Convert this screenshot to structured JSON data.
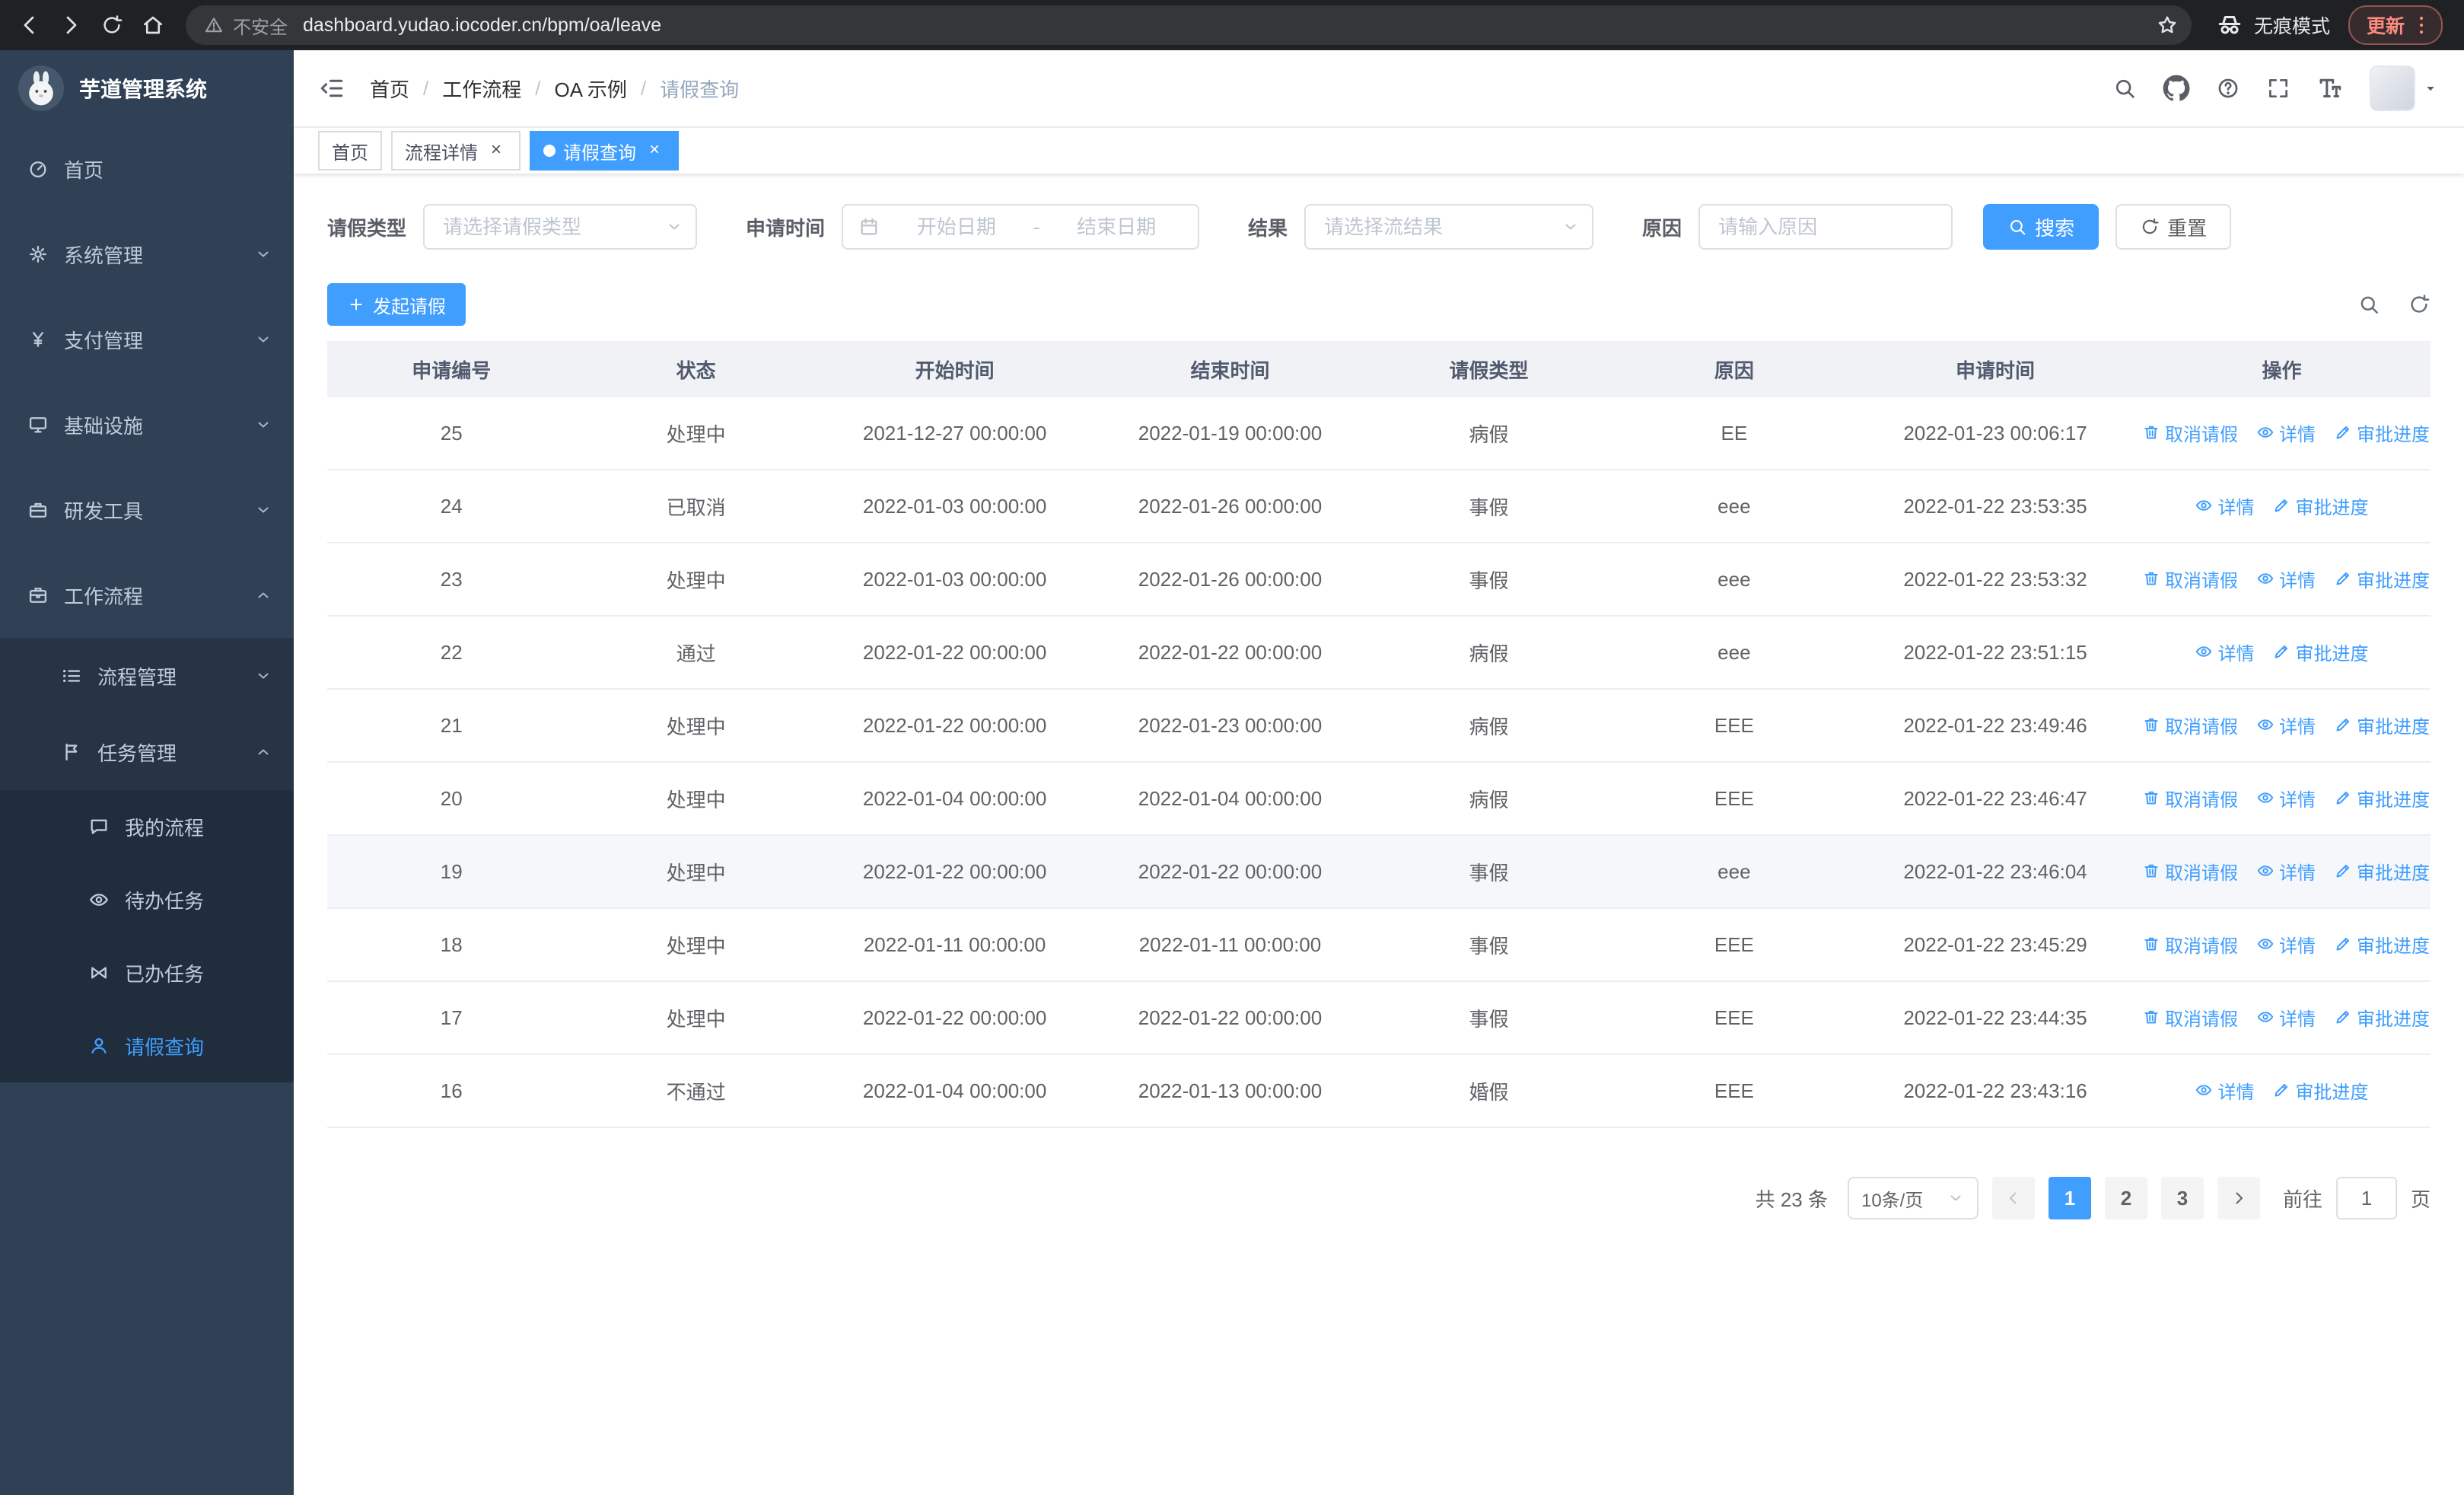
{
  "browser": {
    "security_label": "不安全",
    "url": "dashboard.yudao.iocoder.cn/bpm/oa/leave",
    "incognito_label": "无痕模式",
    "update_label": "更新"
  },
  "sidebar": {
    "logo_title": "芋道管理系统",
    "menu": [
      {
        "name": "home",
        "label": "首页",
        "icon": "dashboard",
        "level": 0
      },
      {
        "name": "system",
        "label": "系统管理",
        "icon": "gear",
        "level": 0,
        "arrow": "down"
      },
      {
        "name": "payment",
        "label": "支付管理",
        "icon": "yen",
        "level": 0,
        "arrow": "down"
      },
      {
        "name": "infrastructure",
        "label": "基础设施",
        "icon": "monitor",
        "level": 0,
        "arrow": "down"
      },
      {
        "name": "devtools",
        "label": "研发工具",
        "icon": "toolbox",
        "level": 0,
        "arrow": "down"
      },
      {
        "name": "workflow",
        "label": "工作流程",
        "icon": "briefcase",
        "level": 0,
        "arrow": "up"
      },
      {
        "name": "process-mgmt",
        "label": "流程管理",
        "icon": "list",
        "level": 1,
        "arrow": "down"
      },
      {
        "name": "task-mgmt",
        "label": "任务管理",
        "icon": "flag",
        "level": 1,
        "arrow": "up"
      },
      {
        "name": "my-process",
        "label": "我的流程",
        "icon": "chat",
        "level": 2
      },
      {
        "name": "todo-tasks",
        "label": "待办任务",
        "icon": "eye",
        "level": 2
      },
      {
        "name": "done-tasks",
        "label": "已办任务",
        "icon": "bowtie",
        "level": 2
      },
      {
        "name": "leave-query",
        "label": "请假查询",
        "icon": "user",
        "level": 2,
        "active": true
      }
    ]
  },
  "header": {
    "breadcrumb": [
      "首页",
      "工作流程",
      "OA 示例",
      "请假查询"
    ]
  },
  "tabs": [
    {
      "label": "首页",
      "closable": false,
      "active": false
    },
    {
      "label": "流程详情",
      "closable": true,
      "active": false
    },
    {
      "label": "请假查询",
      "closable": true,
      "active": true
    }
  ],
  "filters": {
    "leave_type": {
      "label": "请假类型",
      "placeholder": "请选择请假类型"
    },
    "apply_time": {
      "label": "申请时间",
      "start_placeholder": "开始日期",
      "separator": "-",
      "end_placeholder": "结束日期"
    },
    "result": {
      "label": "结果",
      "placeholder": "请选择流结果"
    },
    "reason": {
      "label": "原因",
      "placeholder": "请输入原因"
    },
    "search_label": "搜索",
    "reset_label": "重置"
  },
  "toolbar": {
    "create_label": "发起请假"
  },
  "table": {
    "columns": [
      "申请编号",
      "状态",
      "开始时间",
      "结束时间",
      "请假类型",
      "原因",
      "申请时间",
      "操作"
    ],
    "action_labels": {
      "cancel": "取消请假",
      "detail": "详情",
      "progress": "审批进度"
    },
    "rows": [
      {
        "id": "25",
        "status": "处理中",
        "start": "2021-12-27 00:00:00",
        "end": "2022-01-19 00:00:00",
        "type": "病假",
        "reason": "EE",
        "apply_time": "2022-01-23 00:06:17",
        "actions": [
          "cancel",
          "detail",
          "progress"
        ],
        "highlighted": false
      },
      {
        "id": "24",
        "status": "已取消",
        "start": "2022-01-03 00:00:00",
        "end": "2022-01-26 00:00:00",
        "type": "事假",
        "reason": "eee",
        "apply_time": "2022-01-22 23:53:35",
        "actions": [
          "detail",
          "progress"
        ],
        "highlighted": false
      },
      {
        "id": "23",
        "status": "处理中",
        "start": "2022-01-03 00:00:00",
        "end": "2022-01-26 00:00:00",
        "type": "事假",
        "reason": "eee",
        "apply_time": "2022-01-22 23:53:32",
        "actions": [
          "cancel",
          "detail",
          "progress"
        ],
        "highlighted": false
      },
      {
        "id": "22",
        "status": "通过",
        "start": "2022-01-22 00:00:00",
        "end": "2022-01-22 00:00:00",
        "type": "病假",
        "reason": "eee",
        "apply_time": "2022-01-22 23:51:15",
        "actions": [
          "detail",
          "progress"
        ],
        "highlighted": false
      },
      {
        "id": "21",
        "status": "处理中",
        "start": "2022-01-22 00:00:00",
        "end": "2022-01-23 00:00:00",
        "type": "病假",
        "reason": "EEE",
        "apply_time": "2022-01-22 23:49:46",
        "actions": [
          "cancel",
          "detail",
          "progress"
        ],
        "highlighted": false
      },
      {
        "id": "20",
        "status": "处理中",
        "start": "2022-01-04 00:00:00",
        "end": "2022-01-04 00:00:00",
        "type": "病假",
        "reason": "EEE",
        "apply_time": "2022-01-22 23:46:47",
        "actions": [
          "cancel",
          "detail",
          "progress"
        ],
        "highlighted": false
      },
      {
        "id": "19",
        "status": "处理中",
        "start": "2022-01-22 00:00:00",
        "end": "2022-01-22 00:00:00",
        "type": "事假",
        "reason": "eee",
        "apply_time": "2022-01-22 23:46:04",
        "actions": [
          "cancel",
          "detail",
          "progress"
        ],
        "highlighted": true
      },
      {
        "id": "18",
        "status": "处理中",
        "start": "2022-01-11 00:00:00",
        "end": "2022-01-11 00:00:00",
        "type": "事假",
        "reason": "EEE",
        "apply_time": "2022-01-22 23:45:29",
        "actions": [
          "cancel",
          "detail",
          "progress"
        ],
        "highlighted": false
      },
      {
        "id": "17",
        "status": "处理中",
        "start": "2022-01-22 00:00:00",
        "end": "2022-01-22 00:00:00",
        "type": "事假",
        "reason": "EEE",
        "apply_time": "2022-01-22 23:44:35",
        "actions": [
          "cancel",
          "detail",
          "progress"
        ],
        "highlighted": false
      },
      {
        "id": "16",
        "status": "不通过",
        "start": "2022-01-04 00:00:00",
        "end": "2022-01-13 00:00:00",
        "type": "婚假",
        "reason": "EEE",
        "apply_time": "2022-01-22 23:43:16",
        "actions": [
          "detail",
          "progress"
        ],
        "highlighted": false
      }
    ]
  },
  "pagination": {
    "total_label": "共 23 条",
    "page_size_label": "10条/页",
    "pages": [
      "1",
      "2",
      "3"
    ],
    "active_page": "1",
    "goto_label": "前往",
    "goto_value": "1",
    "page_unit_label": "页"
  },
  "colors": {
    "primary": "#409eff",
    "sidebar_bg": "#304156",
    "sidebar_sub_bg": "#263445",
    "sidebar_deep_bg": "#1f2d3d",
    "chrome_bg": "#202124"
  }
}
